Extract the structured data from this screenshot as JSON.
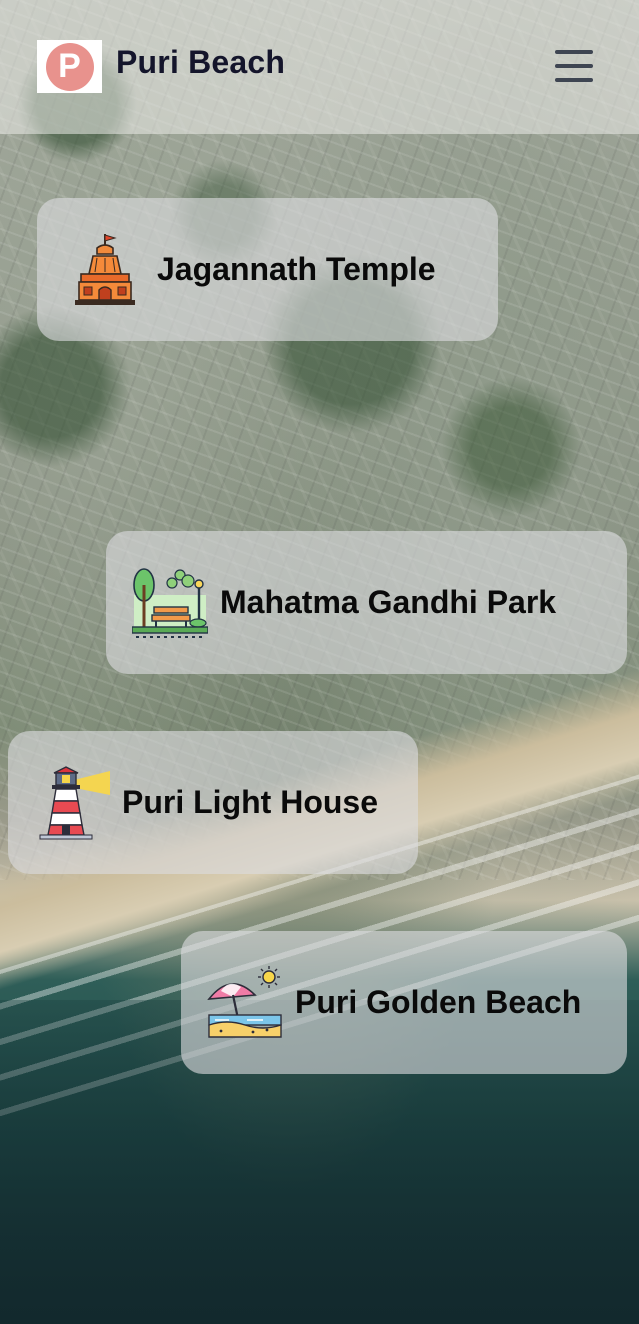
{
  "app": {
    "title": "Puri Beach",
    "logo_letter": "P",
    "logo_color": "#e8928d"
  },
  "header": {
    "menu_icon": "hamburger-menu-icon"
  },
  "places": [
    {
      "label": "Jagannath Temple",
      "icon": "temple-icon"
    },
    {
      "label": "Mahatma Gandhi Park",
      "icon": "park-icon"
    },
    {
      "label": "Puri Light House",
      "icon": "lighthouse-icon"
    },
    {
      "label": "Puri Golden Beach",
      "icon": "beach-umbrella-icon"
    }
  ]
}
